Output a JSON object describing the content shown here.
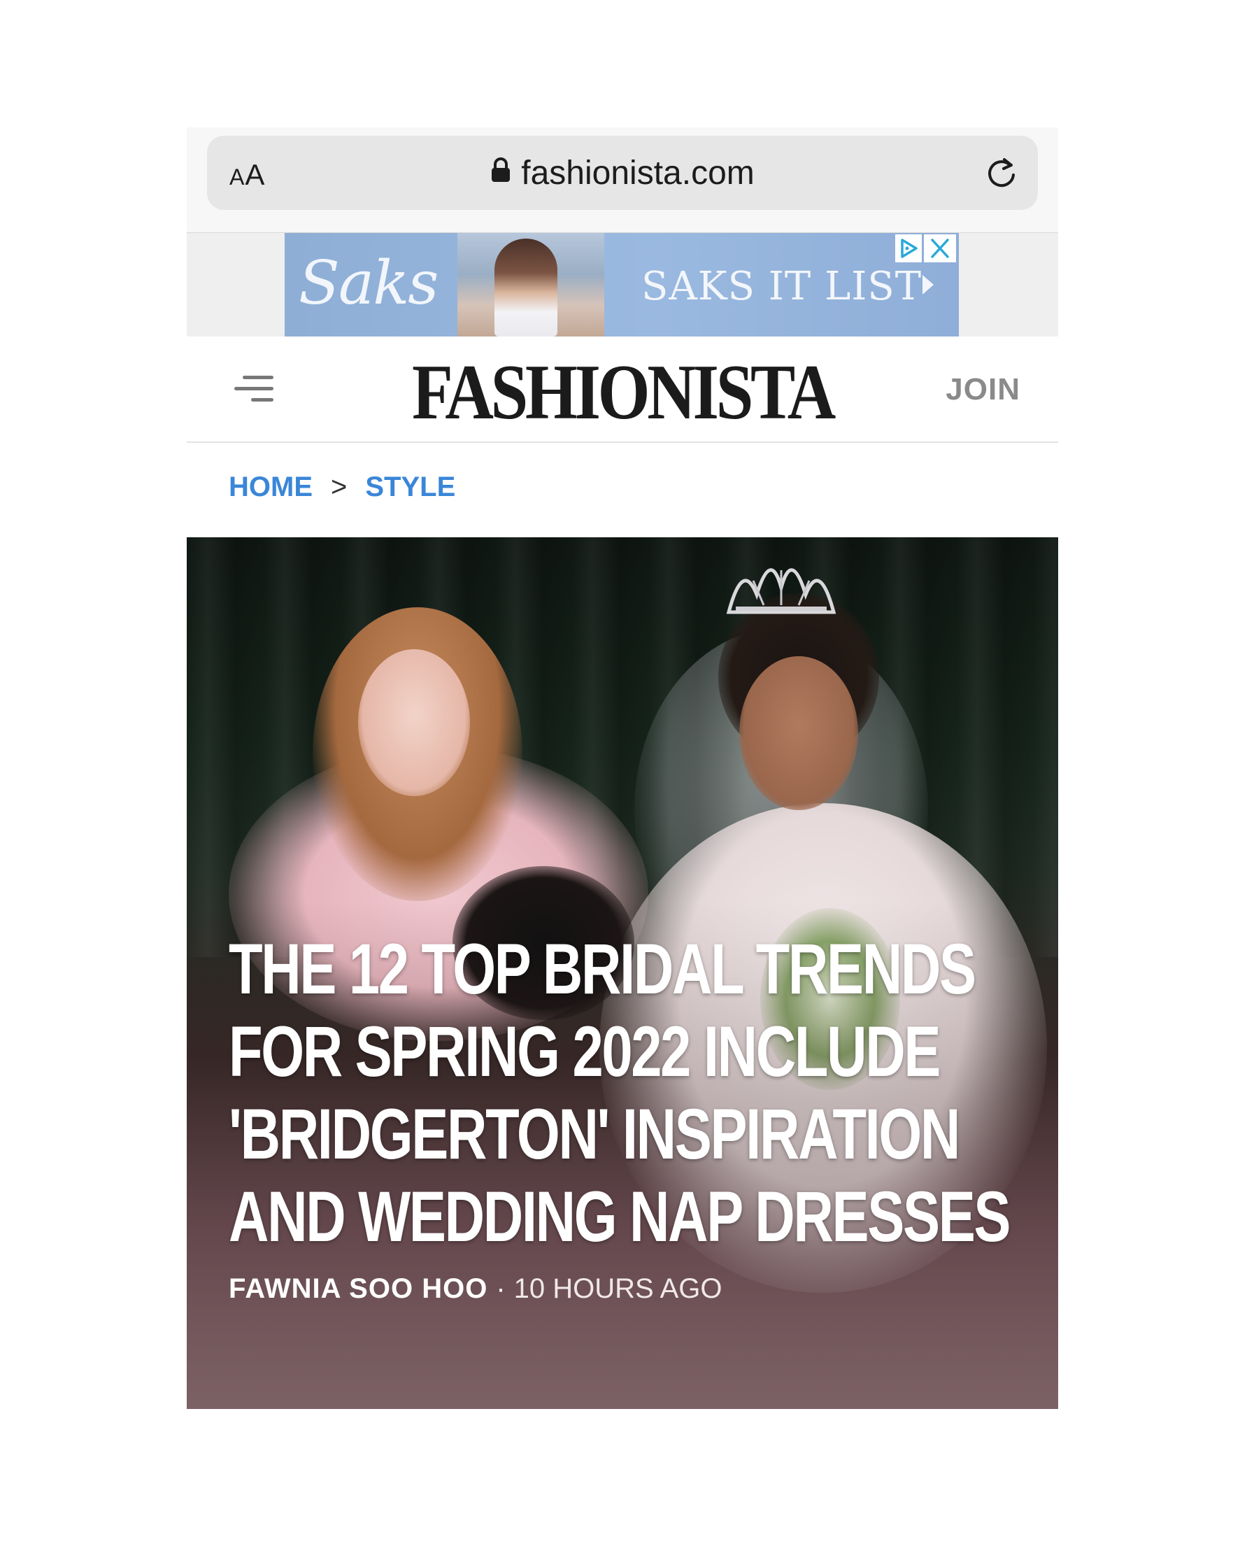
{
  "browser": {
    "text_size_label": "AA",
    "url": "fashionista.com",
    "lock_icon": "lock-icon",
    "reload_icon": "reload-icon"
  },
  "ad": {
    "brand": "Saks",
    "headline": "SAKS IT LIST",
    "icons": [
      "adchoices-icon",
      "close-icon",
      "play-arrow-icon"
    ],
    "colors": {
      "background": "#9ab9e0",
      "text": "#f3f6fa"
    }
  },
  "site": {
    "logo": "FASHIONISTA",
    "join_label": "JOIN",
    "menu_icon": "hamburger-menu-icon"
  },
  "breadcrumb": {
    "items": [
      "HOME",
      "STYLE"
    ],
    "separator": ">",
    "color": "#3a86d8"
  },
  "article": {
    "headline_lines": [
      "THE 12 TOP BRIDAL TRENDS",
      "FOR SPRING 2022 INCLUDE",
      "'BRIDGERTON' INSPIRATION",
      "AND WEDDING NAP DRESSES"
    ],
    "author": "FAWNIA SOO HOO",
    "byline_separator": "·",
    "time": "10 HOURS AGO"
  }
}
